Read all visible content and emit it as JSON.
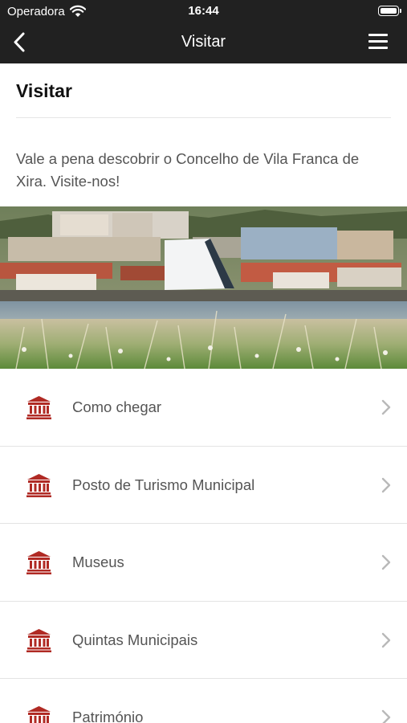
{
  "status_bar": {
    "carrier": "Operadora",
    "time": "16:44"
  },
  "navbar": {
    "title": "Visitar",
    "back_icon": "chevron-left-icon",
    "menu_icon": "hamburger-menu-icon"
  },
  "page": {
    "title": "Visitar",
    "intro": "Vale a pena descobrir o Concelho de Vila Franca de Xira. Visite-nos!",
    "hero_image": "river town waterfront photo"
  },
  "list": {
    "icon": "museum-building-icon",
    "icon_color": "#b02a24",
    "items": [
      {
        "label": "Como chegar"
      },
      {
        "label": "Posto de Turismo Municipal"
      },
      {
        "label": "Museus"
      },
      {
        "label": "Quintas Municipais"
      },
      {
        "label": "Património"
      }
    ]
  },
  "colors": {
    "topbar": "#212121",
    "accent": "#b02a24",
    "text_secondary": "#555555"
  }
}
